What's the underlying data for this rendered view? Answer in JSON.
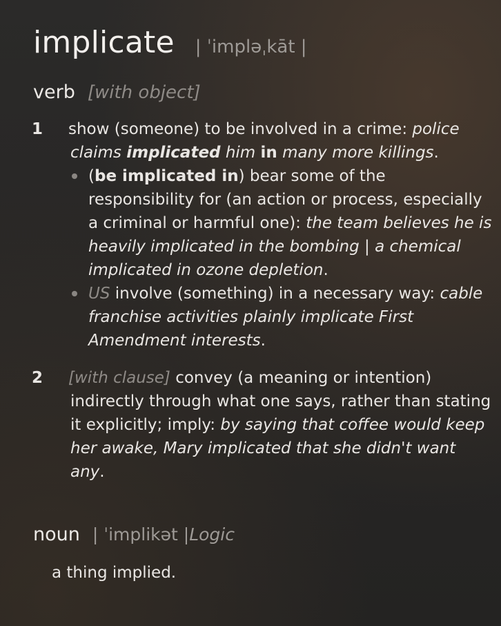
{
  "entry": {
    "headword": "implicate",
    "pronunciation": "| ˈimpləˌkāt |"
  },
  "verb": {
    "pos": "verb",
    "grammar": "[with object]",
    "senses": [
      {
        "number": "1",
        "definition": "show (someone) to be involved in a crime: ",
        "example_a": "police claims ",
        "example_b": "implicated",
        "example_c": " him ",
        "example_d": "in",
        "example_e": " many more killings",
        "end": ".",
        "subsenses": [
          {
            "phrase": "be implicated in",
            "definition": ") bear some of the responsibility for (an action or process, especially a criminal or harmful one): ",
            "example": "the team believes he is heavily implicated in the bombing | a chemical implicated in ozone depletion",
            "end": "."
          },
          {
            "region": "US",
            "definition": " involve (something) in a necessary way: ",
            "example": "cable franchise activities plainly implicate First Amendment interests",
            "end": "."
          }
        ]
      },
      {
        "number": "2",
        "grammar": "[with clause]",
        "definition": " convey (a meaning or intention) indirectly through what one says, rather than stating it explicitly; imply: ",
        "example": "by saying that coffee would keep her awake, Mary implicated that she didn't want any",
        "end": "."
      }
    ]
  },
  "noun": {
    "pos": "noun",
    "pronunciation": "| ˈimplikət | ",
    "domain": "Logic",
    "definition": "a thing implied."
  }
}
